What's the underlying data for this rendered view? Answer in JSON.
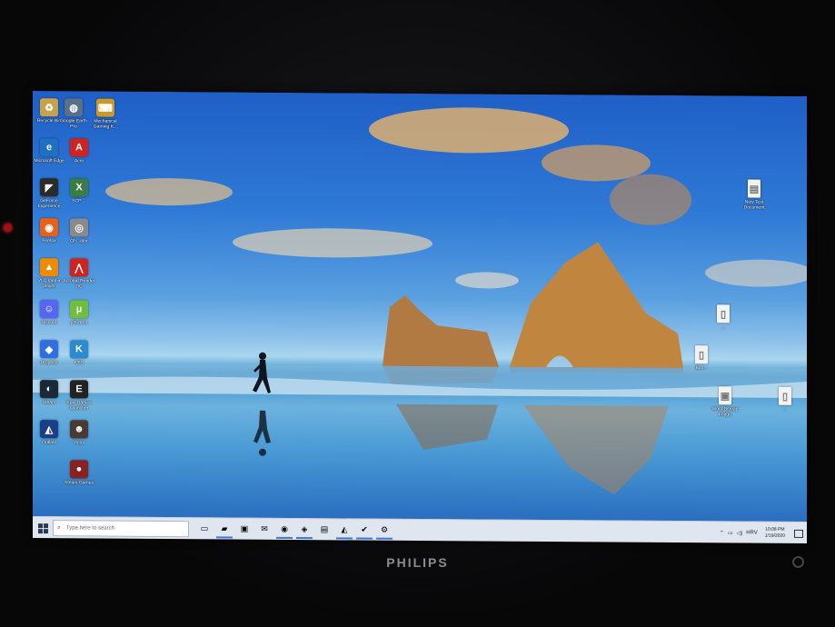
{
  "monitor": {
    "brand": "PHILIPS"
  },
  "desktop": {
    "icons_left": [
      {
        "name": "recycle-bin-icon",
        "label": "Recycle Bin",
        "color": "#c8a24a",
        "glyph": "♻"
      },
      {
        "name": "google-earth-icon",
        "label": "Google Earth Pro",
        "color": "#5a6f8a",
        "glyph": "◍"
      },
      {
        "name": "mechanical-gaming-icon",
        "label": "Mechanical Gaming K...",
        "color": "#c99a2a",
        "glyph": "⌨"
      },
      {
        "name": "edge-icon",
        "label": "Microsoft Edge",
        "color": "#1f6fc2",
        "glyph": "e"
      },
      {
        "name": "acrobat-icon",
        "label": "Acro",
        "color": "#d0221f",
        "glyph": "A"
      },
      {
        "name": "geforce-icon",
        "label": "GeForce Experience",
        "color": "#2b2b2b",
        "glyph": "◤"
      },
      {
        "name": "xbox-icon",
        "label": "SCP ...",
        "color": "#3a7d44",
        "glyph": "X"
      },
      {
        "name": "firefox-icon",
        "label": "Firefox",
        "color": "#e8601a",
        "glyph": "◉"
      },
      {
        "name": "chrome-icon",
        "label": "Gh...ator",
        "color": "#8a8a8a",
        "glyph": "◎"
      },
      {
        "name": "vlc-icon",
        "label": "VLC media player",
        "color": "#f08a00",
        "glyph": "▲"
      },
      {
        "name": "pdf-reader-icon",
        "label": "Acrobat Reader DC",
        "color": "#d0221f",
        "glyph": "⋀"
      },
      {
        "name": "discord-icon",
        "label": "Discord",
        "color": "#5865f2",
        "glyph": "☺"
      },
      {
        "name": "utorrent-icon",
        "label": "µTorrent",
        "color": "#6fbf3c",
        "glyph": "µ"
      },
      {
        "name": "dropbox-icon",
        "label": "Dropbox",
        "color": "#2f6fe0",
        "glyph": "◆"
      },
      {
        "name": "kbs-icon",
        "label": "KBS",
        "color": "#2b8ad0",
        "glyph": "K"
      },
      {
        "name": "steam-icon",
        "label": "Steam",
        "color": "#1b2838",
        "glyph": "◐"
      },
      {
        "name": "epic-games-icon",
        "label": "Epic Games Launcher",
        "color": "#222222",
        "glyph": "E"
      },
      {
        "name": "ps-icon",
        "label": "Outlast",
        "color": "#1b3d8a",
        "glyph": "◭"
      },
      {
        "name": "person-photo-icon",
        "label": "Victor",
        "color": "#4a3a30",
        "glyph": "☻"
      },
      {
        "name": "ball-icon",
        "label": "Steam Games",
        "color": "#8a2020",
        "glyph": "●"
      }
    ],
    "icons_right": [
      {
        "name": "text-document-icon",
        "label": "New Text Document",
        "color": "#f2f2f2",
        "glyph": "▤"
      },
      {
        "name": "file-icon",
        "label": "...",
        "color": "#f2f2f2",
        "glyph": "▯"
      },
      {
        "name": "file-icon-2",
        "label": "Ban...",
        "color": "#f2f2f2",
        "glyph": "▯"
      },
      {
        "name": "image-file-icon",
        "label": "Word Bitmap Image",
        "color": "#f2f2f2",
        "glyph": "▣"
      },
      {
        "name": "blank-file-icon",
        "label": "...",
        "color": "#f2f2f2",
        "glyph": "▯"
      }
    ]
  },
  "taskbar": {
    "search_placeholder": "Type here to search",
    "pinned": [
      {
        "name": "task-view-icon",
        "glyph": "▭",
        "active": false
      },
      {
        "name": "file-explorer-icon",
        "glyph": "▰",
        "active": true
      },
      {
        "name": "store-icon",
        "glyph": "▣",
        "active": false
      },
      {
        "name": "mail-icon",
        "glyph": "✉",
        "active": false
      },
      {
        "name": "firefox-taskbar-icon",
        "glyph": "◉",
        "active": true
      },
      {
        "name": "messenger-icon",
        "glyph": "◈",
        "active": true
      },
      {
        "name": "terminal-icon",
        "glyph": "▤",
        "active": false
      },
      {
        "name": "photos-icon",
        "glyph": "◭",
        "active": true
      },
      {
        "name": "steam-taskbar-icon",
        "glyph": "✔",
        "active": true
      },
      {
        "name": "settings-icon",
        "glyph": "⚙",
        "active": true
      }
    ],
    "tray": {
      "language": "HRV",
      "time": "10:08 PM",
      "date": "1/19/2020"
    }
  }
}
